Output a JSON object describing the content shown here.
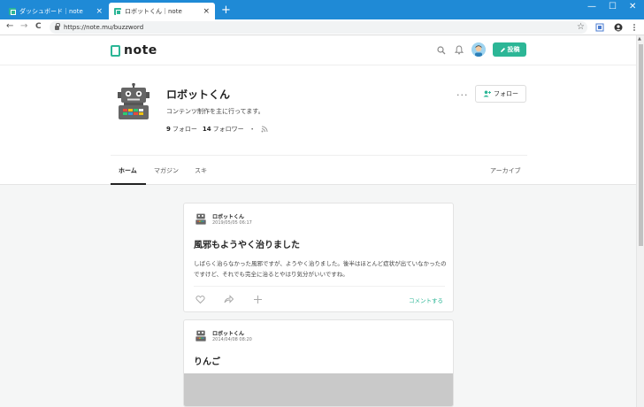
{
  "browser": {
    "tabs": [
      {
        "title": "ダッシュボード｜note",
        "close": "×"
      },
      {
        "title": "ロボットくん｜note",
        "close": "×"
      }
    ],
    "new_tab": "+",
    "window_controls": {
      "minimize": "—",
      "maximize": "☐",
      "close": "✕"
    },
    "url": "https://note.mu/buzzword",
    "nav": {
      "back": "←",
      "forward": "→",
      "reload": "C"
    },
    "star": "☆"
  },
  "header": {
    "logo_text": "note",
    "post_label": "投稿",
    "accent": "#2cb696"
  },
  "profile": {
    "name": "ロボットくん",
    "bio": "コンテンツ制作を主に行ってます。",
    "following_count": "9",
    "following_label": "フォロー",
    "followers_count": "14",
    "followers_label": "フォロワー",
    "separator": "・",
    "more": "···",
    "follow_label": "フォロー"
  },
  "tabs": {
    "home": "ホーム",
    "magazine": "マガジン",
    "likes": "スキ",
    "archive": "アーカイブ"
  },
  "posts": [
    {
      "author": "ロボットくん",
      "date": "2019/05/05 06:17",
      "title": "風邪もようやく治りました",
      "body": "しばらく治らなかった風邪ですが、ようやく治りました。後半はほとんど症状が出ていなかったのですけど、それでも完全に治るとやはり気分がいいですね。",
      "comment": "コメントする"
    },
    {
      "author": "ロボットくん",
      "date": "2014/04/08 08:20",
      "title": "りんご"
    }
  ]
}
